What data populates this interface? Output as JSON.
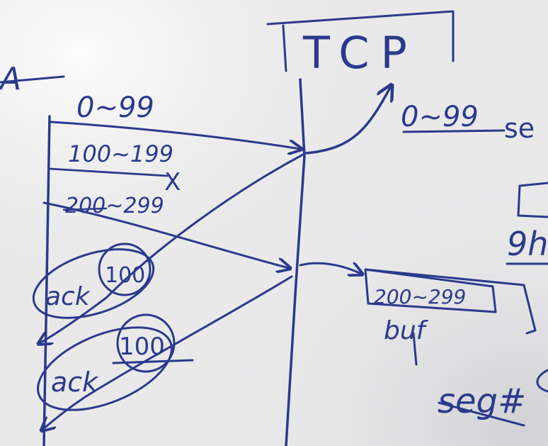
{
  "whiteboard": {
    "title": "TCP",
    "header_left": "A",
    "segments": {
      "seg1": "0~99",
      "seg2": "100~199",
      "seg3": "200~299"
    },
    "lost_mark": "X",
    "acks": {
      "ack1_label": "ack",
      "ack1_value": "100",
      "ack2_label": "ack",
      "ack2_value": "100"
    },
    "right_side": {
      "delivered": "0~99",
      "delivered_suffix": "se",
      "buffer_content": "200~299",
      "buffer_label": "buf",
      "seg_label": "seg#",
      "partial_right": "9h"
    },
    "colors": {
      "ink": "#2a3a8c",
      "board": "#e9e9ea"
    }
  }
}
